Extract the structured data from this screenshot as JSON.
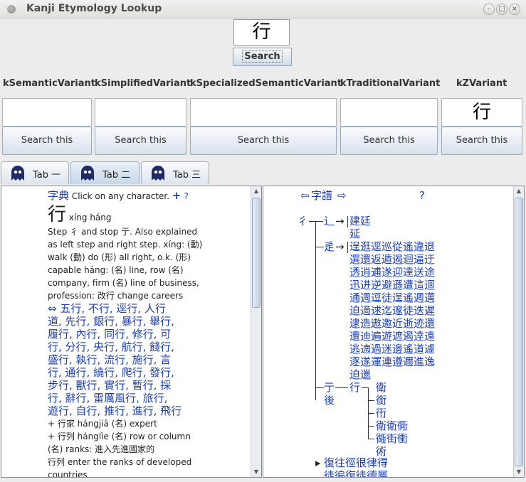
{
  "window": {
    "title": "Kanji Etymology Lookup"
  },
  "search": {
    "value": "行",
    "button_label": "Search"
  },
  "variants": [
    {
      "label": "kSemanticVariant",
      "value": "",
      "button": "Search this"
    },
    {
      "label": "kSimplifiedVariant",
      "value": "",
      "button": "Search this"
    },
    {
      "label": "kSpecializedSemanticVariant",
      "value": "",
      "button": "Search this"
    },
    {
      "label": "kTraditionalVariant",
      "value": "",
      "button": "Search this"
    },
    {
      "label": "kZVariant",
      "value": "行",
      "button": "Search this"
    }
  ],
  "tabs": [
    {
      "label": "Tab 一",
      "active": false
    },
    {
      "label": "Tab 二",
      "active": true
    },
    {
      "label": "Tab 三",
      "active": false
    }
  ],
  "left_pane": {
    "header_icon": "字典",
    "header_text": "Click on any character.",
    "plus": "+",
    "question": "?",
    "headword": "行",
    "reading": "xíng háng",
    "lines": [
      "Step 彳 and stop 亍. Also explained",
      "as left step and right step. xíng: (動)",
      "walk (動) do (形) all right, o.k. (形)",
      "capable háng: (名) line, row (名)",
      "company, firm (名) line of business,",
      "profession: 改行 change careers"
    ],
    "compounds": [
      "⇔ 五行, 不行, 逕行, 人行",
      "道, 先行, 銀行, 暴行, 舉行,",
      "履行, 內行, 同行, 修行, 可",
      "行, 分行, 央行, 航行, 餞行,",
      "盛行, 執行, 流行, 施行, 言",
      "行, 通行, 繞行, 爬行, 發行,",
      "步行, 獸行, 實行, 暫行, 採",
      "行, 辭行, 雷厲風行, 旅行,",
      "遊行, 自行, 推行, 進行, 飛行"
    ],
    "entries": [
      "+ 行家 hángjiā (名) expert",
      "+ 行列 hánglìe (名) row or column",
      "(名) ranks: 進入先進國家的",
      "行列 enter the ranks of developed",
      "countries"
    ]
  },
  "right_pane": {
    "header_left": "⇦",
    "header_icon": "字譜",
    "header_right": "⇨",
    "question": "?",
    "root": "彳",
    "branch1": "⻌",
    "branch1_children": [
      "建廷",
      "延"
    ],
    "branch2": "辵",
    "branch2_rows": [
      "逞逛逕巡從遙違退",
      "選還返遁遏迴逼迂",
      "透逍逋遂迎達送途",
      "迅进逆避遜遭這迴",
      "通週逗徒逞遙週邁",
      "迫適逑迄邃徒迭遲",
      "逮造遨邀近逝迹還",
      "遭迪遍遊遮遏逹遠",
      "逃遖過迷邊遙道遽",
      "逐遂運連遵邇進逸",
      "迫邋"
    ],
    "branch3": "亍",
    "branch3_mid": "行",
    "branch3_children": [
      "衛",
      "銜",
      "衎",
      "衛衛衕",
      "衚街衝",
      "術"
    ],
    "branch3_after": "後",
    "bottom_rows": [
      "復往徑很律得",
      "徒徧復徒德屬"
    ]
  },
  "colors": {
    "link": "#1d3fb8",
    "tab_active": "#c7d6e8"
  },
  "icons": [
    "window-menu-icon",
    "minimize-icon",
    "maximize-icon",
    "close-icon",
    "ghost-tab-icon"
  ]
}
